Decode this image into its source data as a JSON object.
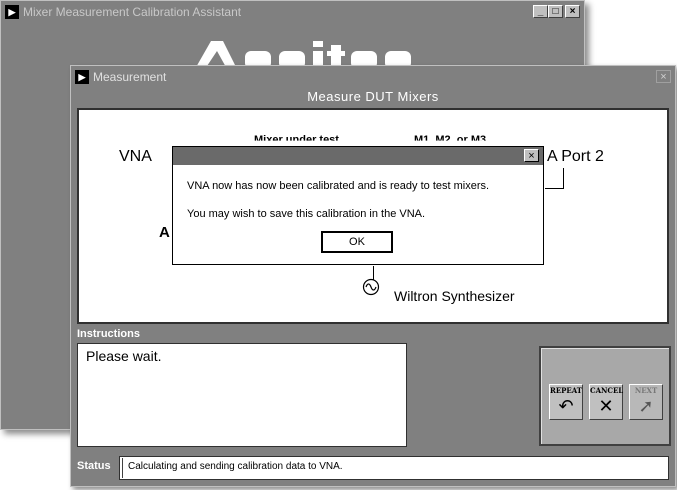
{
  "main_window": {
    "title": "Mixer Measurement Calibration Assistant",
    "controls": [
      "_",
      "□",
      "×"
    ]
  },
  "measurement_window": {
    "title": "Measurement",
    "close": "×",
    "heading": "Measure DUT Mixers"
  },
  "diagram": {
    "vna": "VNA",
    "port2": "A Port 2",
    "a_label": "A",
    "mixer_under_test": "Mixer under test",
    "mixer_ids": "M1, M2, or M3",
    "synthesizer": "Wiltron Synthesizer"
  },
  "dialog": {
    "close": "×",
    "message1": "VNA now has now been calibrated and is ready to test mixers.",
    "message2": "You may wish to save this calibration in the VNA.",
    "ok_label": "OK"
  },
  "instructions": {
    "label": "Instructions",
    "text": "Please wait."
  },
  "buttons": {
    "repeat": "REPEAT",
    "cancel": "CANCEL",
    "next": "NEXT"
  },
  "status": {
    "label": "Status",
    "text": "Calculating and sending calibration data to VNA."
  }
}
